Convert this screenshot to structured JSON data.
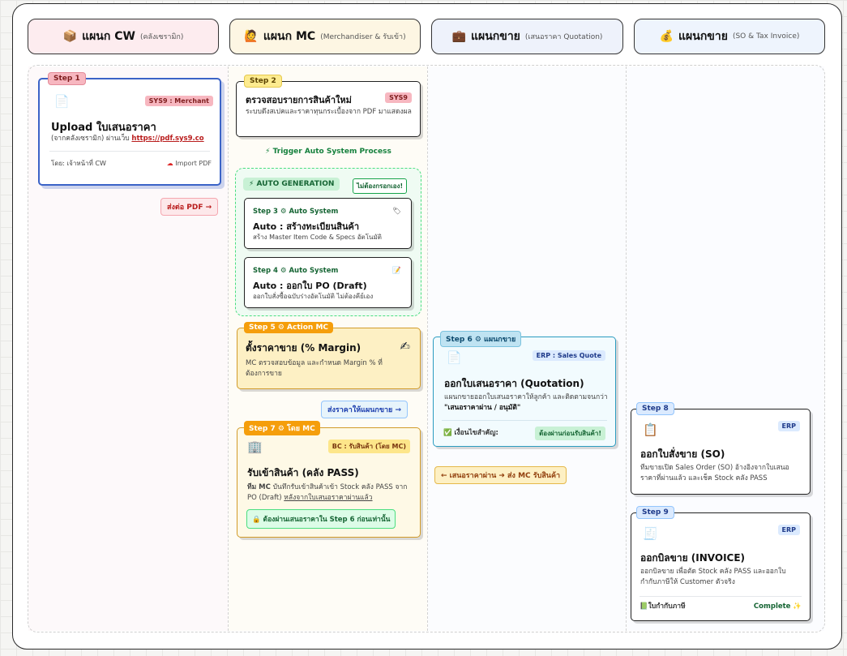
{
  "columns": [
    {
      "icon": "📦",
      "title": "แผนก CW",
      "sub": "(คลังเซรามิก)"
    },
    {
      "icon": "🙋",
      "title": "แผนก MC",
      "sub": "(Merchandiser & รับเข้า)"
    },
    {
      "icon": "💼",
      "title": "แผนกขาย",
      "sub": "(เสนอราคา Quotation)"
    },
    {
      "icon": "💰",
      "title": "แผนกขาย",
      "sub": "(SO & Tax Invoice)"
    }
  ],
  "step1": {
    "tag": "Step 1",
    "icon": "📄",
    "badge": "SYS9 : Merchant",
    "title": "Upload ใบเสนอราคา",
    "desc_prefix": "(จากคลังเซรามิก) ผ่านเว็บ ",
    "link": "https://pdf.sys9.co",
    "by": "โดย: เจ้าหน้าที่ CW",
    "import_icon": "☁",
    "import": "Import PDF"
  },
  "send_pdf": "ส่งต่อ PDF →",
  "step2": {
    "tag": "Step 2",
    "badge": "SYS9",
    "title": "ตรวจสอบรายการสินค้าใหม่",
    "desc": "ระบบดึงสเปคและราคาทุนกระเบื้องจาก PDF มาแสดงผล"
  },
  "trigger": "⚡ Trigger Auto System Process",
  "auto": {
    "label": "⚡ AUTO GENERATION",
    "note": "ไม่ต้องกรอกเอง!"
  },
  "step3": {
    "tag": "Step 3 ⚙ Auto System",
    "icon": "🏷",
    "title": "Auto : สร้างทะเบียนสินค้า",
    "desc": "สร้าง Master Item Code & Specs อัตโนมัติ"
  },
  "step4": {
    "tag": "Step 4 ⚙ Auto System",
    "icon": "📝",
    "title": "Auto : ออกใบ PO (Draft)",
    "desc": "ออกใบสั่งซื้อฉบับร่างอัตโนมัติ ไม่ต้องคีย์เอง"
  },
  "step5": {
    "tag": "Step 5 ⚙ Action MC",
    "icon": "✍",
    "title": "ตั้งราคาขาย (% Margin)",
    "desc": "MC ตรวจสอบข้อมูล และกำหนด Margin % ที่ต้องการขาย"
  },
  "send_sales": "ส่งราคาให้แผนกขาย →",
  "step7": {
    "tag": "Step 7 ⚙ โดย MC",
    "icon": "🏢",
    "badge": "BC : รับสินค้า (โดย MC)",
    "title": "รับเข้าสินค้า (คลัง PASS)",
    "desc_bold": "ทีม MC",
    "desc_mid": " บันทึกรับเข้าสินค้าเข้า Stock คลัง PASS จาก PO (Draft) ",
    "desc_under": "หลังจากใบเสนอราคาผ่านแล้ว",
    "lock": "🔒 ต้องผ่านเสนอราคาใน Step 6 ก่อนเท่านั้น"
  },
  "step6": {
    "tag": "Step 6 ⚙ แผนกขาย",
    "icon": "📄",
    "badge": "ERP : Sales Quote",
    "title": "ออกใบเสนอราคา (Quotation)",
    "desc_pre": "แผนกขายออกใบเสนอราคาให้ลูกค้า และติดตามจนกว่า ",
    "desc_bold": "\"เสนอราคาผ่าน / อนุมัติ\"",
    "cond": "✅ เงื่อนไขสำคัญ:",
    "cond_badge": "ต้องผ่านก่อนรับสินค้า!"
  },
  "back": "← เสนอราคาผ่าน ➜ ส่ง MC รับสินค้า",
  "step8": {
    "tag": "Step 8",
    "icon": "📋",
    "badge": "ERP",
    "title": "ออกใบสั่งขาย (SO)",
    "desc": "ทีมขายเปิด Sales Order (SO) อ้างอิงจากใบเสนอราคาที่ผ่านแล้ว และเช็ค Stock คลัง PASS"
  },
  "step9": {
    "tag": "Step 9",
    "icon": "🧾",
    "badge": "ERP",
    "title": "ออกบิลขาย (INVOICE)",
    "desc": "ออกบิลขาย เพื่อตัด Stock คลัง PASS และออกใบกำกับภาษีให้ Customer ตัวจริง",
    "tax": "📗ใบกำกับภาษี",
    "complete": "Complete ✨"
  },
  "colors": {
    "cw": "#fdecef",
    "mc": "#fdf6e3",
    "sales": "#eef2fb",
    "invoice": "#eef4fd",
    "red": "#b91c1c",
    "green": "#15803d",
    "amber": "#b45309",
    "blue": "#1d4ed8"
  }
}
